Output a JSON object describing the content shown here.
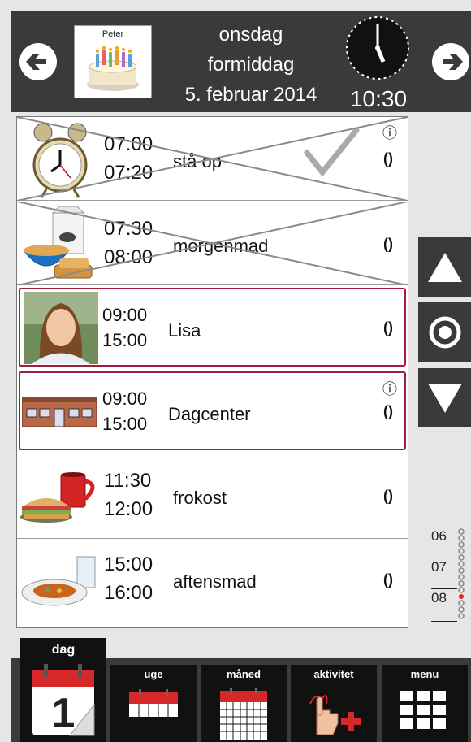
{
  "header": {
    "profile_name": "Peter",
    "weekday": "onsdag",
    "daypart": "formiddag",
    "date": "5. februar 2014",
    "time": "10:30"
  },
  "activities": [
    {
      "start": "07:00",
      "end": "07:20",
      "title": "stå op",
      "done": true,
      "info": true,
      "icon": "alarm-clock-icon"
    },
    {
      "start": "07:30",
      "end": "08:00",
      "title": "morgenmad",
      "done": true,
      "info": false,
      "icon": "breakfast-icon"
    },
    {
      "start": "09:00",
      "end": "15:00",
      "title": "Lisa",
      "selected": true,
      "info": false,
      "icon": "person-photo"
    },
    {
      "start": "09:00",
      "end": "15:00",
      "title": "Dagcenter",
      "selected": true,
      "info": true,
      "icon": "building-icon"
    },
    {
      "start": "11:30",
      "end": "12:00",
      "title": "frokost",
      "info": false,
      "icon": "sandwich-mug-icon"
    },
    {
      "start": "15:00",
      "end": "16:00",
      "title": "aftensmad",
      "info": false,
      "icon": "dinner-plate-icon"
    }
  ],
  "icons": {
    "info": "ⓘ",
    "repeat": "()",
    "check": "✓"
  },
  "timeline": {
    "ticks": [
      "06",
      "07",
      "08"
    ]
  },
  "tabs": [
    {
      "label": "dag",
      "icon": "calendar-day-icon",
      "active": true
    },
    {
      "label": "uge",
      "icon": "calendar-week-icon"
    },
    {
      "label": "måned",
      "icon": "calendar-month-icon"
    },
    {
      "label": "aktivitet",
      "icon": "add-activity-icon"
    },
    {
      "label": "menu",
      "icon": "grid-menu-icon"
    }
  ],
  "colors": {
    "header_bg": "#3a3a3a",
    "selected_border": "#a01d3c",
    "accent_red": "#d62828"
  }
}
